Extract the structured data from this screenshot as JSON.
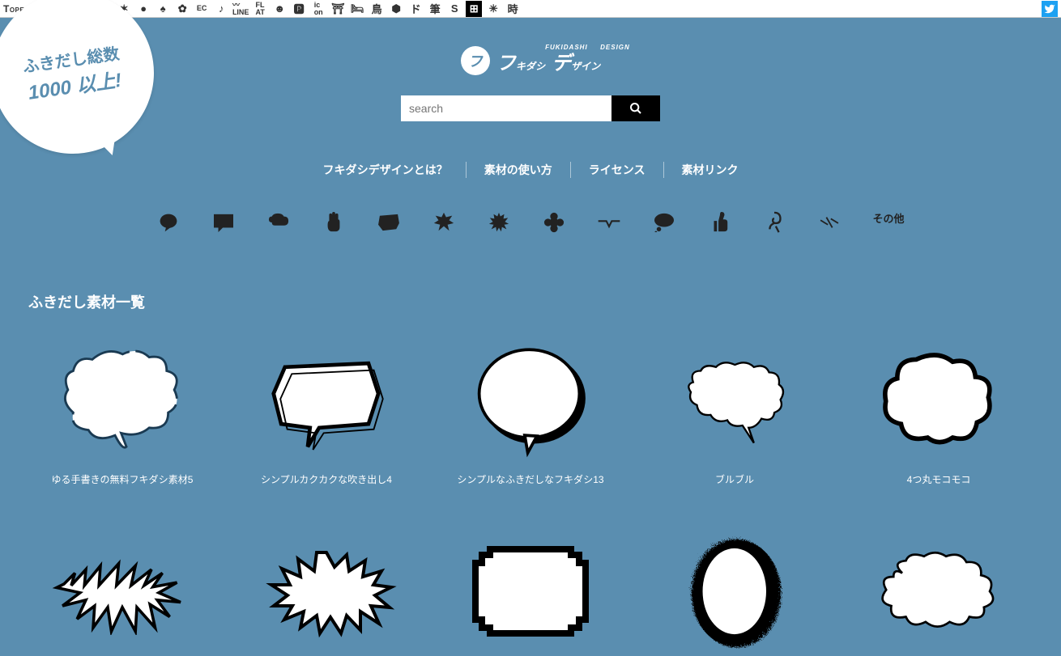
{
  "topbar": {
    "brand": "TopeconHeroes",
    "twitter": "twitter"
  },
  "corner": {
    "line1": "ふきだし総数",
    "line2": "1000 以上!"
  },
  "logo": {
    "mark": "フ",
    "t1": "フ",
    "t1_sub": "キダシ",
    "t1_sup": "FUKIDASHI",
    "t2": "デ",
    "t2_sub": "ザイン",
    "t2_sup": "DESIGN"
  },
  "search": {
    "placeholder": "search"
  },
  "nav": {
    "items": [
      "フキダシデザインとは？",
      "素材の使い方",
      "ライセンス",
      "素材リンク"
    ]
  },
  "categories": {
    "other": "その他"
  },
  "section": {
    "title": "ふきだし素材一覧"
  },
  "items": [
    {
      "title": "ゆる手書きの無料フキダシ素材5"
    },
    {
      "title": "シンプルカクカクな吹き出し4"
    },
    {
      "title": "シンプルなふきだしなフキダシ13"
    },
    {
      "title": "ブルブル"
    },
    {
      "title": "4つ丸モコモコ"
    },
    {
      "title": ""
    },
    {
      "title": ""
    },
    {
      "title": ""
    },
    {
      "title": ""
    },
    {
      "title": ""
    }
  ]
}
